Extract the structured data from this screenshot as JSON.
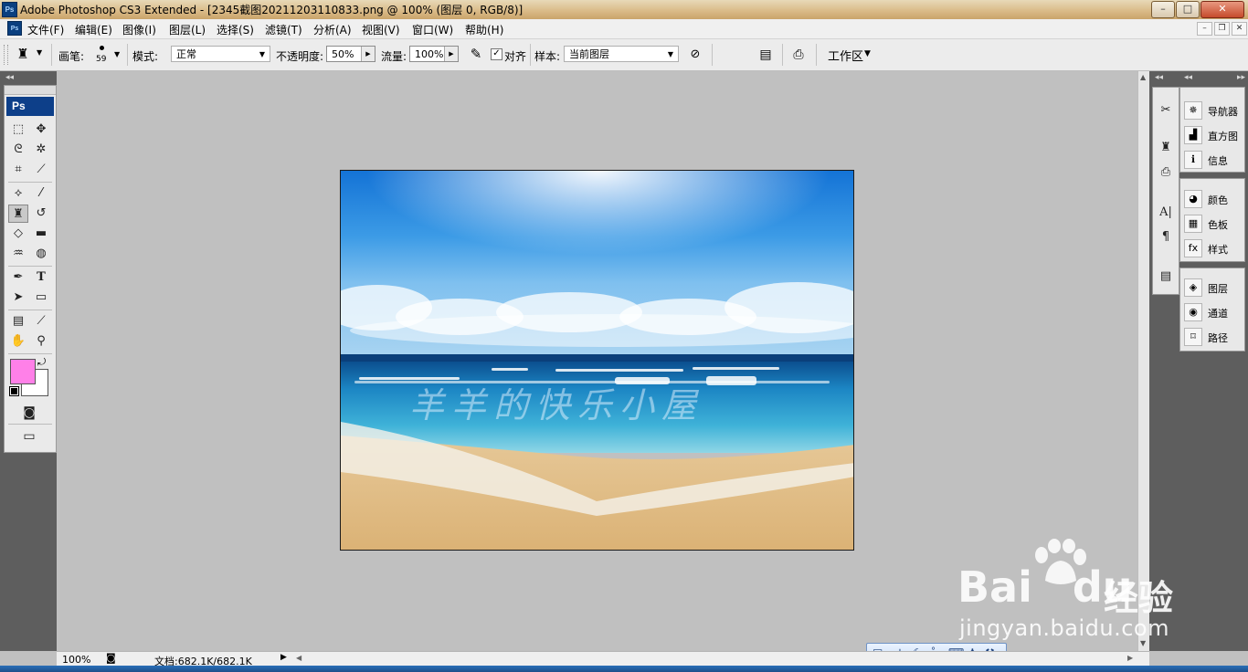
{
  "titlebar": {
    "app_icon": "Ps",
    "title": "Adobe Photoshop CS3 Extended - [2345截图20211203110833.png @ 100% (图层 0, RGB/8)]",
    "buttons": {
      "minimize": "–",
      "maximize": "□",
      "close": "✕"
    }
  },
  "menubar": {
    "items": [
      "文件(F)",
      "编辑(E)",
      "图像(I)",
      "图层(L)",
      "选择(S)",
      "滤镜(T)",
      "分析(A)",
      "视图(V)",
      "窗口(W)",
      "帮助(H)"
    ],
    "doc_buttons": {
      "minimize": "–",
      "restore": "❐",
      "close": "✕"
    }
  },
  "options": {
    "brush_label": "画笔:",
    "brush_size": "59",
    "mode_label": "模式:",
    "mode_value": "正常",
    "opacity_label": "不透明度:",
    "opacity_value": "50%",
    "flow_label": "流量:",
    "flow_value": "100%",
    "aligned_label": "对齐",
    "aligned_checked": true,
    "sample_label": "样本:",
    "sample_value": "当前图层",
    "workspace_label": "工作区"
  },
  "toolbox": {
    "header": "Ps",
    "foreground_color": "#ff80e8",
    "background_color": "#ffffff",
    "active_tool": "clone-stamp-tool"
  },
  "panels": {
    "group1": [
      "导航器",
      "直方图",
      "信息"
    ],
    "group2": [
      "颜色",
      "色板",
      "样式"
    ],
    "group3": [
      "图层",
      "通道",
      "路径"
    ]
  },
  "canvas": {
    "watermark_text": "羊羊的快乐小屋"
  },
  "statusbar": {
    "zoom": "100%",
    "doc_info": "文档:682.1K/682.1K"
  },
  "ime_bar": {
    "mode": "中"
  },
  "site_watermark": {
    "brand": "Bai",
    "brand_suffix": "du",
    "product": "经验",
    "url": "jingyan.baidu.com"
  }
}
